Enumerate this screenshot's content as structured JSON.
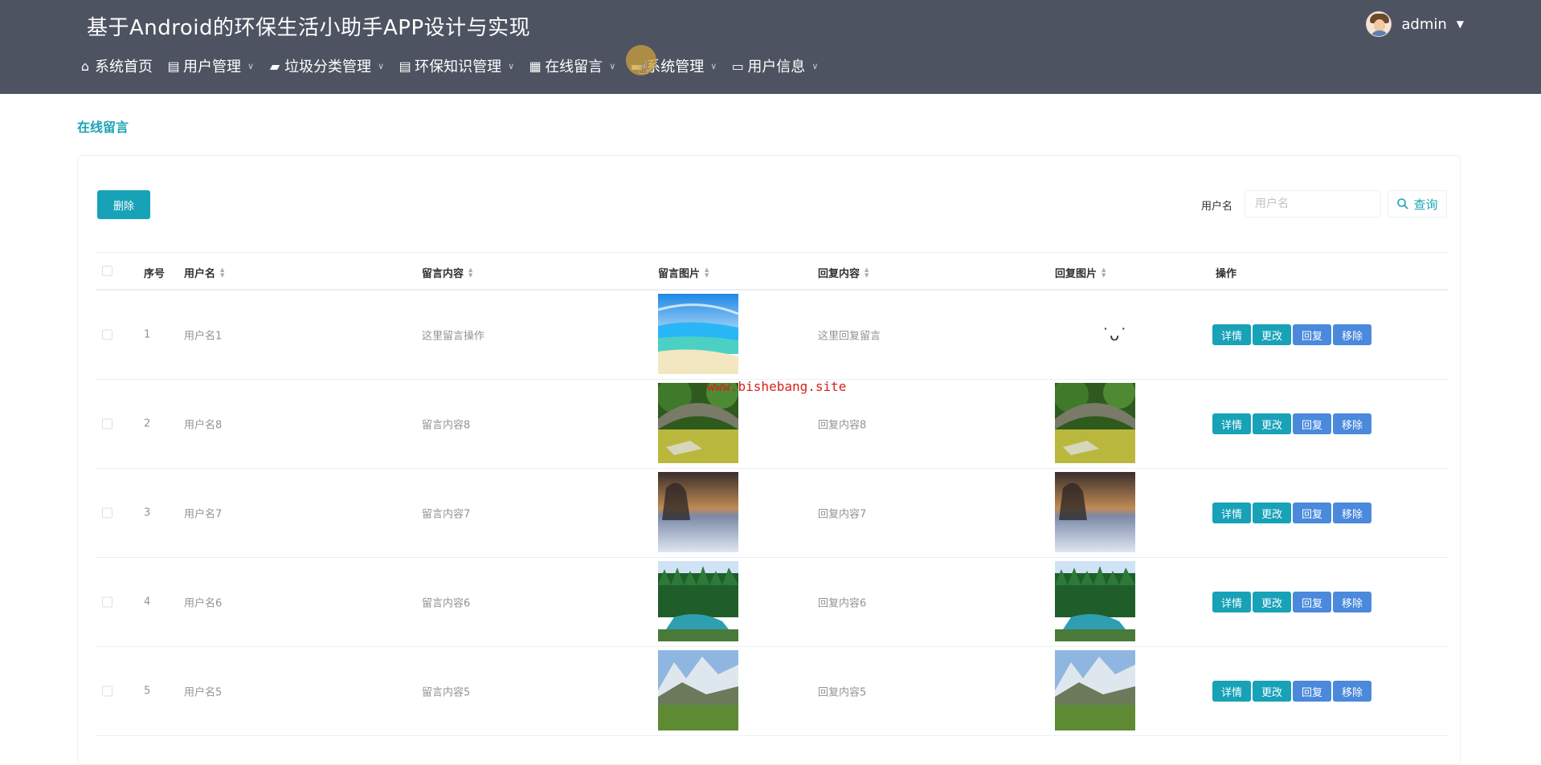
{
  "header": {
    "title": "基于Android的环保生活小助手APP设计与实现",
    "user": "admin",
    "nav": [
      {
        "label": "系统首页",
        "icon": "home-icon",
        "glyph": "⌂",
        "dropdown": false
      },
      {
        "label": "用户管理",
        "icon": "clipboard-icon",
        "glyph": "▤",
        "dropdown": true
      },
      {
        "label": "垃圾分类管理",
        "icon": "briefcase-icon",
        "glyph": "▰",
        "dropdown": true
      },
      {
        "label": "环保知识管理",
        "icon": "clipboard-icon",
        "glyph": "▤",
        "dropdown": true
      },
      {
        "label": "在线留言",
        "icon": "grid-icon",
        "glyph": "▦",
        "dropdown": true
      },
      {
        "label": "系统管理",
        "icon": "folder-icon",
        "glyph": "▬",
        "dropdown": true
      },
      {
        "label": "用户信息",
        "icon": "card-icon",
        "glyph": "▭",
        "dropdown": true
      }
    ]
  },
  "breadcrumb": "在线留言",
  "toolbar": {
    "delete_label": "删除",
    "search_label": "用户名",
    "search_placeholder": "用户名",
    "search_button": "查询"
  },
  "table": {
    "columns": [
      "序号",
      "用户名",
      "留言内容",
      "留言图片",
      "回复内容",
      "回复图片",
      "操作"
    ],
    "rows": [
      {
        "index": "1",
        "username": "用户名1",
        "content": "这里留言操作",
        "image": "beach",
        "reply": "这里回复留言",
        "reply_image": "emoji"
      },
      {
        "index": "2",
        "username": "用户名8",
        "content": "留言内容8",
        "image": "bridge",
        "reply": "回复内容8",
        "reply_image": "bridge"
      },
      {
        "index": "3",
        "username": "用户名7",
        "content": "留言内容7",
        "image": "sunset",
        "reply": "回复内容7",
        "reply_image": "sunset"
      },
      {
        "index": "4",
        "username": "用户名6",
        "content": "留言内容6",
        "image": "forest",
        "reply": "回复内容6",
        "reply_image": "forest"
      },
      {
        "index": "5",
        "username": "用户名5",
        "content": "留言内容5",
        "image": "mountain",
        "reply": "回复内容5",
        "reply_image": "mountain"
      }
    ],
    "actions": [
      "详情",
      "更改",
      "回复",
      "移除"
    ]
  },
  "watermark": "www.bishebang.site"
}
